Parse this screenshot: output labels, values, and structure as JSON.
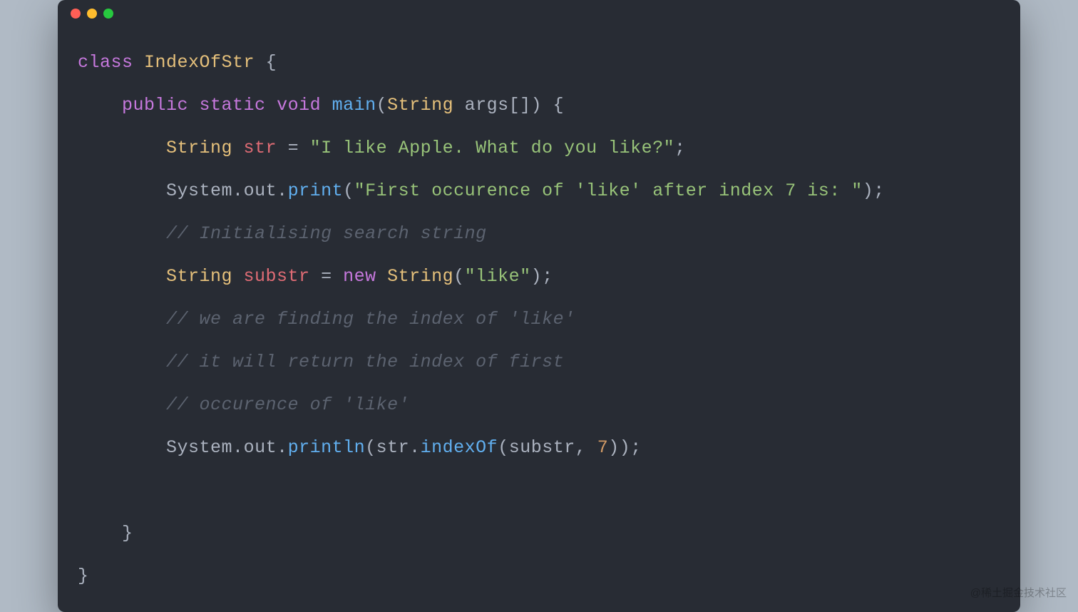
{
  "code": {
    "line1": {
      "class_kw": "class",
      "class_name": "IndexOfStr",
      "brace": " {"
    },
    "line2": {
      "indent": "    ",
      "public_kw": "public",
      "static_kw": " static",
      "void_kw": " void",
      "main": " main",
      "paren_open": "(",
      "string_type": "String",
      "args": " args",
      "brackets": "[]",
      "paren_close": ")",
      "brace": " {"
    },
    "line3": {
      "indent": "        ",
      "type": "String",
      "var": " str",
      "eq": " = ",
      "str": "\"I like Apple. What do you like?\"",
      "semi": ";"
    },
    "line4": {
      "indent": "        ",
      "system": "System",
      "dot1": ".",
      "out": "out",
      "dot2": ".",
      "print": "print",
      "paren_open": "(",
      "str": "\"First occurence of 'like' after index 7 is: \"",
      "paren_close": ")",
      "semi": ";"
    },
    "line5": {
      "indent": "        ",
      "comment": "// Initialising search string"
    },
    "line6": {
      "indent": "        ",
      "type": "String",
      "var": " substr",
      "eq": " = ",
      "new_kw": "new",
      "space": " ",
      "ctor": "String",
      "paren_open": "(",
      "str": "\"like\"",
      "paren_close": ")",
      "semi": ";"
    },
    "line7": {
      "indent": "        ",
      "comment": "// we are finding the index of 'like'"
    },
    "line8": {
      "indent": "        ",
      "comment": "// it will return the index of first"
    },
    "line9": {
      "indent": "        ",
      "comment": "// occurence of 'like'"
    },
    "line10": {
      "indent": "        ",
      "system": "System",
      "dot1": ".",
      "out": "out",
      "dot2": ".",
      "println": "println",
      "paren_open": "(",
      "str_var": "str",
      "dot3": ".",
      "indexof": "indexOf",
      "paren_open2": "(",
      "substr_var": "substr",
      "comma": ", ",
      "num": "7",
      "paren_close2": ")",
      "paren_close": ")",
      "semi": ";"
    },
    "line12": {
      "indent": "    ",
      "brace": "}"
    },
    "line13": {
      "brace": "}"
    }
  },
  "watermark": "@稀土掘金技术社区"
}
